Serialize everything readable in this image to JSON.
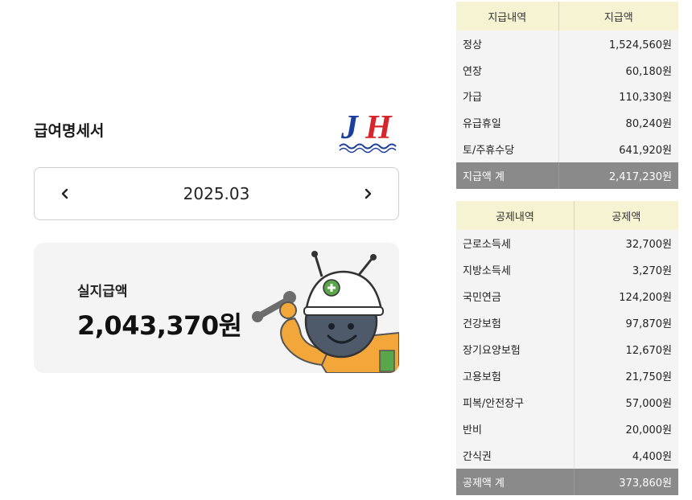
{
  "page": {
    "title": "급여명세서"
  },
  "logo": {
    "text": "JH",
    "icon": "company-logo"
  },
  "month_selector": {
    "value": "2025.03",
    "prev_icon": "chevron-left-icon",
    "next_icon": "chevron-right-icon"
  },
  "net_pay": {
    "label": "실지급액",
    "value": "2,043,370원"
  },
  "earnings": {
    "headers": [
      "지급내역",
      "지급액"
    ],
    "rows": [
      {
        "item": "정상",
        "amount": "1,524,560원"
      },
      {
        "item": "연장",
        "amount": "60,180원"
      },
      {
        "item": "가급",
        "amount": "110,330원"
      },
      {
        "item": "유급휴일",
        "amount": "80,240원"
      },
      {
        "item": "토/주휴수당",
        "amount": "641,920원"
      }
    ],
    "total": {
      "item": "지급액 계",
      "amount": "2,417,230원"
    }
  },
  "deductions": {
    "headers": [
      "공제내역",
      "공제액"
    ],
    "rows": [
      {
        "item": "근로소득세",
        "amount": "32,700원"
      },
      {
        "item": "지방소득세",
        "amount": "3,270원"
      },
      {
        "item": "국민연금",
        "amount": "124,200원"
      },
      {
        "item": "건강보험",
        "amount": "97,870원"
      },
      {
        "item": "장기요양보험",
        "amount": "12,670원"
      },
      {
        "item": "고용보험",
        "amount": "21,750원"
      },
      {
        "item": "피복/안전장구",
        "amount": "57,000원"
      },
      {
        "item": "반비",
        "amount": "20,000원"
      },
      {
        "item": "간식권",
        "amount": "4,400원"
      }
    ],
    "total": {
      "item": "공제액 계",
      "amount": "373,860원"
    }
  },
  "colors": {
    "header_bg": "#f6f3d3",
    "total_bg": "#8a8a8a",
    "row_bg": "#f4f4f4",
    "logo_blue": "#1b3f9c",
    "logo_red": "#d6262b"
  }
}
